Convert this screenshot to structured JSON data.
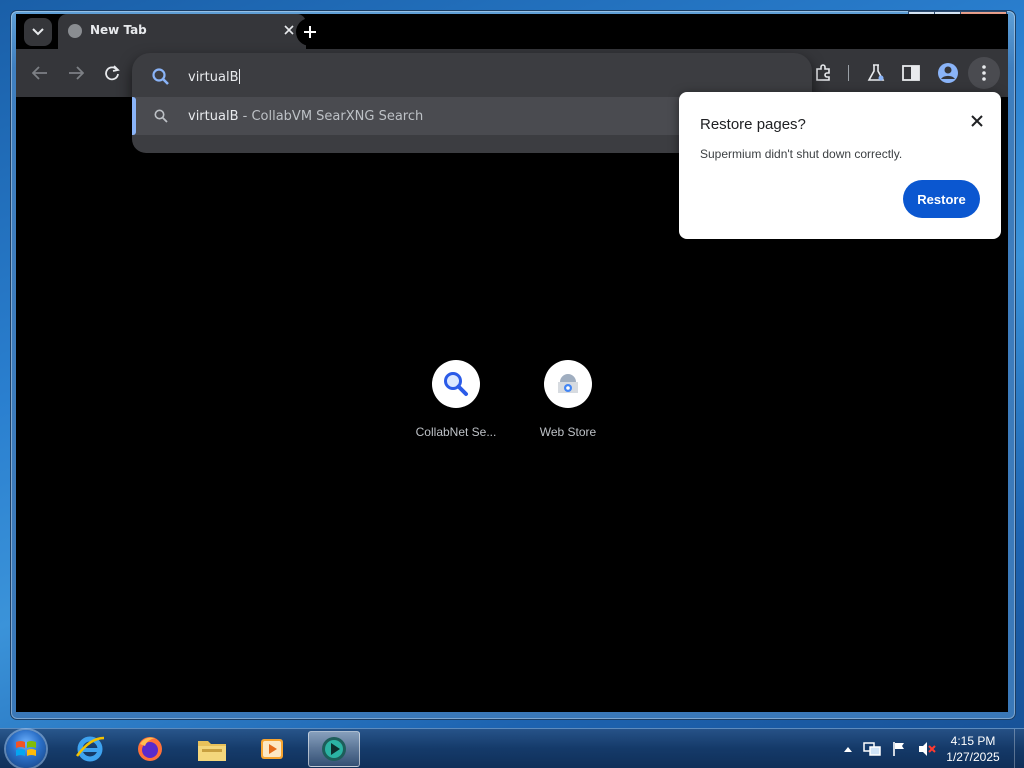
{
  "browser": {
    "tab": {
      "title": "New Tab"
    },
    "omnibox": {
      "value": "virtualB"
    },
    "suggestion": {
      "query": "virtualB",
      "separator": " - ",
      "description": "CollabVM SearXNG Search"
    },
    "icons": {
      "tab_search": "chevron-down-icon",
      "new_tab": "plus-icon",
      "back": "arrow-left-icon",
      "forward": "arrow-right-icon",
      "reload": "reload-icon",
      "extensions": "puzzle-icon",
      "labs": "flask-icon",
      "side_panel": "side-panel-icon",
      "profile": "profile-icon",
      "menu": "kebab-icon"
    }
  },
  "restore_popup": {
    "title": "Restore pages?",
    "message": "Supermium didn't shut down correctly.",
    "button": "Restore",
    "button_color": "#0b57d0"
  },
  "shortcuts": [
    {
      "label": "CollabNet Se...",
      "icon": "search-magnifier-icon"
    },
    {
      "label": "Web Store",
      "icon": "web-store-icon"
    }
  ],
  "taskbar": {
    "items": [
      "start-orb",
      "internet-explorer-icon",
      "firefox-icon",
      "file-explorer-icon",
      "media-player-icon",
      "supermium-icon"
    ],
    "clock": {
      "time": "4:15 PM",
      "date": "1/27/2025"
    }
  },
  "colors": {
    "accent": "#8ab4f8",
    "toolbar": "#35363a",
    "page_bg": "#000000"
  }
}
